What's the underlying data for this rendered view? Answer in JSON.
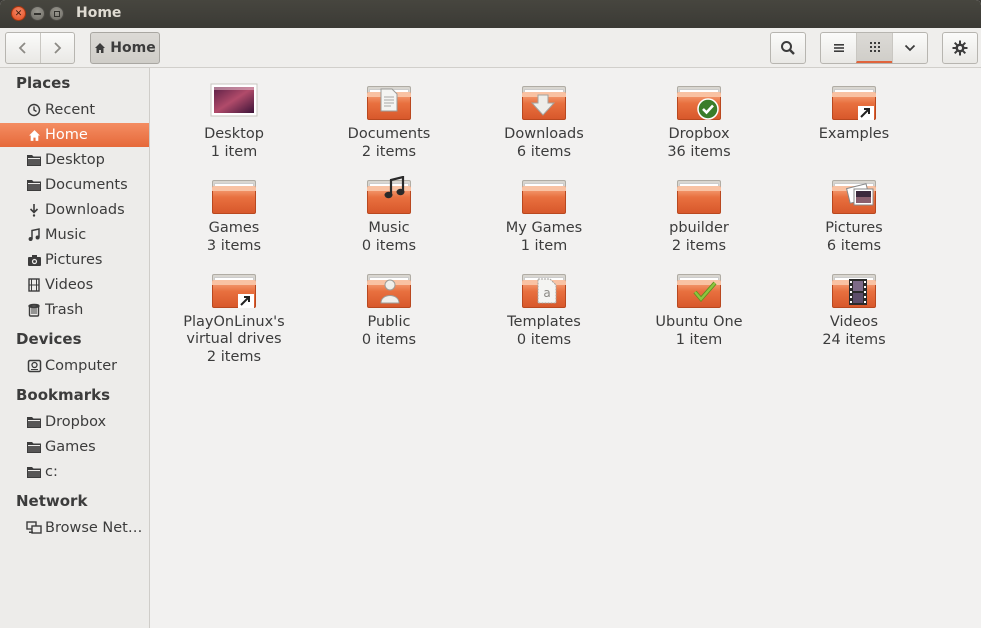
{
  "window": {
    "title": "Home"
  },
  "toolbar": {
    "location_label": "Home"
  },
  "sidebar": {
    "sections": [
      {
        "title": "Places",
        "items": [
          {
            "label": "Recent",
            "icon": "clock-icon"
          },
          {
            "label": "Home",
            "icon": "home-icon",
            "active": true
          },
          {
            "label": "Desktop",
            "icon": "folder-icon"
          },
          {
            "label": "Documents",
            "icon": "folder-icon"
          },
          {
            "label": "Downloads",
            "icon": "download-icon"
          },
          {
            "label": "Music",
            "icon": "music-icon"
          },
          {
            "label": "Pictures",
            "icon": "camera-icon"
          },
          {
            "label": "Videos",
            "icon": "film-icon"
          },
          {
            "label": "Trash",
            "icon": "trash-icon"
          }
        ]
      },
      {
        "title": "Devices",
        "items": [
          {
            "label": "Computer",
            "icon": "drive-icon"
          }
        ]
      },
      {
        "title": "Bookmarks",
        "items": [
          {
            "label": "Dropbox",
            "icon": "folder-icon"
          },
          {
            "label": "Games",
            "icon": "folder-icon"
          },
          {
            "label": "c:",
            "icon": "folder-icon"
          }
        ]
      },
      {
        "title": "Network",
        "items": [
          {
            "label": "Browse Net…",
            "icon": "network-icon"
          }
        ]
      }
    ]
  },
  "files": [
    {
      "name": "Desktop",
      "count": "1 item",
      "emblem": "desktop"
    },
    {
      "name": "Documents",
      "count": "2 items",
      "emblem": "document"
    },
    {
      "name": "Downloads",
      "count": "6 items",
      "emblem": "download"
    },
    {
      "name": "Dropbox",
      "count": "36 items",
      "emblem": "check-green"
    },
    {
      "name": "Examples",
      "count": "",
      "emblem": "link"
    },
    {
      "name": "Games",
      "count": "3 items",
      "emblem": "none"
    },
    {
      "name": "Music",
      "count": "0 items",
      "emblem": "music"
    },
    {
      "name": "My Games",
      "count": "1 item",
      "emblem": "none"
    },
    {
      "name": "pbuilder",
      "count": "2 items",
      "emblem": "none"
    },
    {
      "name": "Pictures",
      "count": "6 items",
      "emblem": "picture"
    },
    {
      "name": "PlayOnLinux's\nvirtual drives",
      "count": "2 items",
      "emblem": "link"
    },
    {
      "name": "Public",
      "count": "0 items",
      "emblem": "person"
    },
    {
      "name": "Templates",
      "count": "0 items",
      "emblem": "template"
    },
    {
      "name": "Ubuntu One",
      "count": "1 item",
      "emblem": "check"
    },
    {
      "name": "Videos",
      "count": "24 items",
      "emblem": "film"
    }
  ],
  "colors": {
    "accent": "#e6693a",
    "folder": "#e8703f"
  }
}
